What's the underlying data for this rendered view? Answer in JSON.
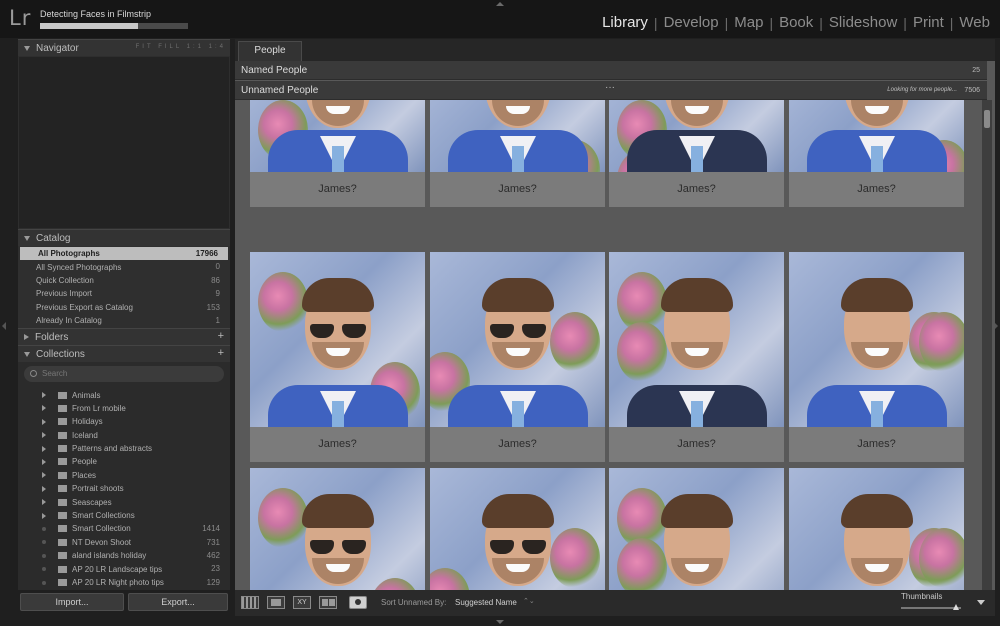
{
  "app": {
    "logo": "Lr",
    "activity_text": "Detecting Faces in Filmstrip",
    "activity_progress": 0.66
  },
  "modules": [
    {
      "label": "Library",
      "active": true
    },
    {
      "label": "Develop",
      "active": false
    },
    {
      "label": "Map",
      "active": false
    },
    {
      "label": "Book",
      "active": false
    },
    {
      "label": "Slideshow",
      "active": false
    },
    {
      "label": "Print",
      "active": false
    },
    {
      "label": "Web",
      "active": false
    }
  ],
  "navigator": {
    "title": "Navigator",
    "zoom_options": "FIT FILL 1:1 1:4"
  },
  "catalog": {
    "title": "Catalog",
    "items": [
      {
        "label": "All Photographs",
        "count": "17966",
        "selected": true
      },
      {
        "label": "All Synced Photographs",
        "count": "0"
      },
      {
        "label": "Quick Collection",
        "count": "86"
      },
      {
        "label": "Previous Import",
        "count": "9"
      },
      {
        "label": "Previous Export as Catalog",
        "count": "153"
      },
      {
        "label": "Already In Catalog",
        "count": "1"
      }
    ]
  },
  "folders": {
    "title": "Folders",
    "add": "+"
  },
  "collections": {
    "title": "Collections",
    "add": "+",
    "search_placeholder": "Search",
    "items": [
      {
        "label": "Animals",
        "count": "",
        "expandable": true
      },
      {
        "label": "From Lr mobile",
        "count": "",
        "expandable": true
      },
      {
        "label": "Holidays",
        "count": "",
        "expandable": true
      },
      {
        "label": "Iceland",
        "count": "",
        "expandable": true
      },
      {
        "label": "Patterns and abstracts",
        "count": "",
        "expandable": true
      },
      {
        "label": "People",
        "count": "",
        "expandable": true
      },
      {
        "label": "Places",
        "count": "",
        "expandable": true
      },
      {
        "label": "Portrait shoots",
        "count": "",
        "expandable": true
      },
      {
        "label": "Seascapes",
        "count": "",
        "expandable": true
      },
      {
        "label": "Smart Collections",
        "count": "",
        "expandable": true
      },
      {
        "label": "Smart Collection",
        "count": "1414",
        "expandable": false
      },
      {
        "label": "NT Devon Shoot",
        "count": "731",
        "expandable": false
      },
      {
        "label": "aland islands holiday",
        "count": "462",
        "expandable": false
      },
      {
        "label": "AP 20 LR Landscape tips",
        "count": "23",
        "expandable": false
      },
      {
        "label": "AP 20 LR Night photo tips",
        "count": "129",
        "expandable": false
      }
    ]
  },
  "buttons": {
    "import": "Import...",
    "export": "Export..."
  },
  "people": {
    "tab": "People",
    "named": {
      "label": "Named People",
      "count": "25"
    },
    "unnamed": {
      "label": "Unnamed People",
      "count": "7506",
      "status": "Looking for more people...",
      "menu": "···"
    },
    "faces": [
      {
        "name": "James?",
        "shades": false,
        "jacket": "blue"
      },
      {
        "name": "James?",
        "shades": false,
        "jacket": "blue"
      },
      {
        "name": "James?",
        "shades": false,
        "jacket": "dark"
      },
      {
        "name": "James?",
        "shades": false,
        "jacket": "blue"
      },
      {
        "name": "James?",
        "shades": true,
        "jacket": "blue"
      },
      {
        "name": "James?",
        "shades": true,
        "jacket": "blue"
      },
      {
        "name": "James?",
        "shades": false,
        "jacket": "dark"
      },
      {
        "name": "James?",
        "shades": false,
        "jacket": "blue"
      },
      {
        "name": "",
        "shades": true,
        "jacket": "blue"
      },
      {
        "name": "",
        "shades": true,
        "jacket": "blue"
      },
      {
        "name": "",
        "shades": false,
        "jacket": "blue"
      },
      {
        "name": "",
        "shades": false,
        "jacket": "blue"
      }
    ]
  },
  "toolbar": {
    "compare_label": "XY",
    "sort_label": "Sort Unnamed By:",
    "sort_value": "Suggested Name",
    "sort_arrows": "⌃⌄",
    "thumbnails_label": "Thumbnails",
    "thumbnail_size": 0.92
  }
}
